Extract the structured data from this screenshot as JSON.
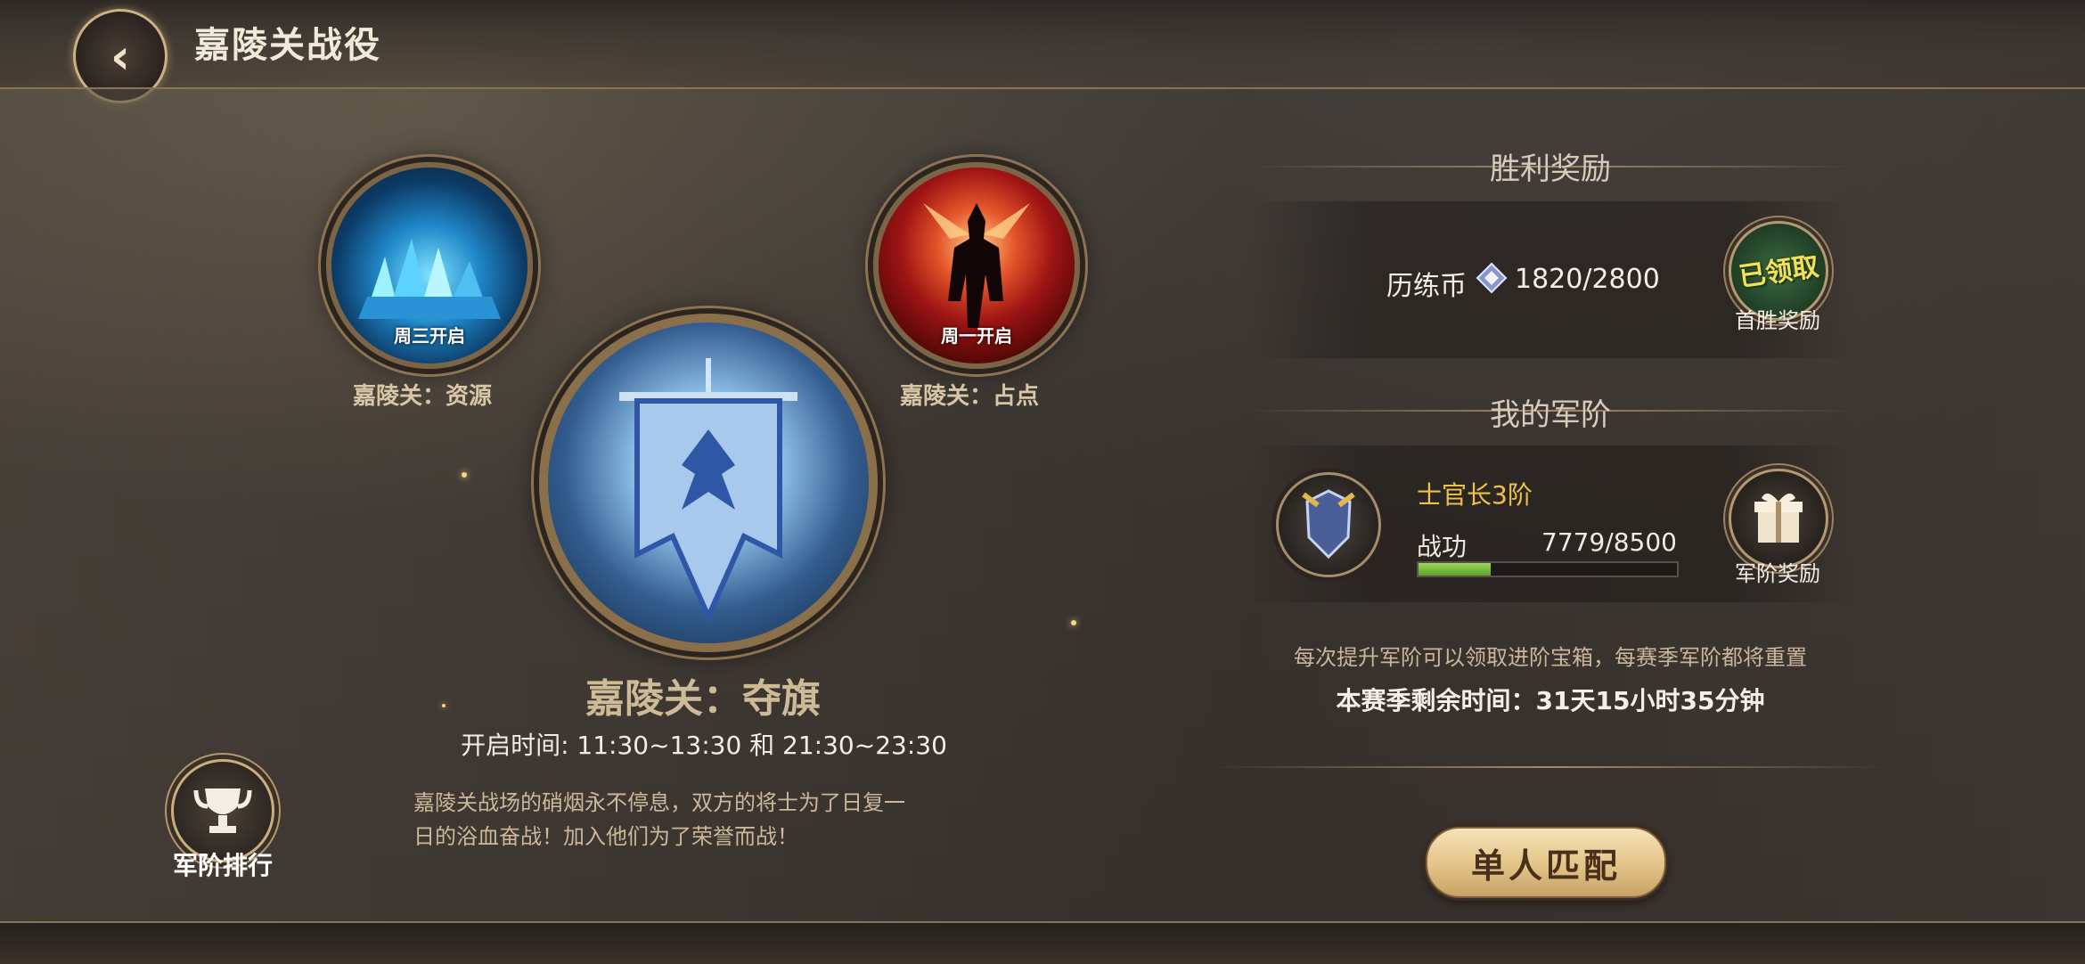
{
  "header": {
    "title": "嘉陵关战役"
  },
  "modes": {
    "resource": {
      "badge": "周三开启",
      "label": "嘉陵关：资源"
    },
    "capture": {
      "badge": "周一开启",
      "label": "嘉陵关：占点"
    },
    "flag": {
      "title": "嘉陵关：夺旗",
      "open_time": "开启时间: 11:30~13:30 和 21:30~23:30",
      "desc_line1": "嘉陵关战场的硝烟永不停息，双方的将士为了日复一",
      "desc_line2": "日的浴血奋战！加入他们为了荣誉而战！"
    }
  },
  "rank_ranking": {
    "label": "军阶排行"
  },
  "victory": {
    "title": "胜利奖励",
    "coin_label": "历练币",
    "coin_value": "1820/2800",
    "claimed_stamp": "已领取",
    "first_win_label": "首胜奖励"
  },
  "my_rank": {
    "title": "我的军阶",
    "rank_name": "士官长3阶",
    "merit_label": "战功",
    "merit_value": "7779/8500",
    "merit_progress": 0.28,
    "reward_label": "军阶奖励"
  },
  "info": {
    "line1": "每次提升军阶可以领取进阶宝箱，每赛季军阶都将重置",
    "line2": "本赛季剩余时间：31天15小时35分钟"
  },
  "match_button": "单人匹配",
  "colors": {
    "gold": "#eec14f",
    "progress": "#7cc245",
    "button": "#e2c388"
  }
}
